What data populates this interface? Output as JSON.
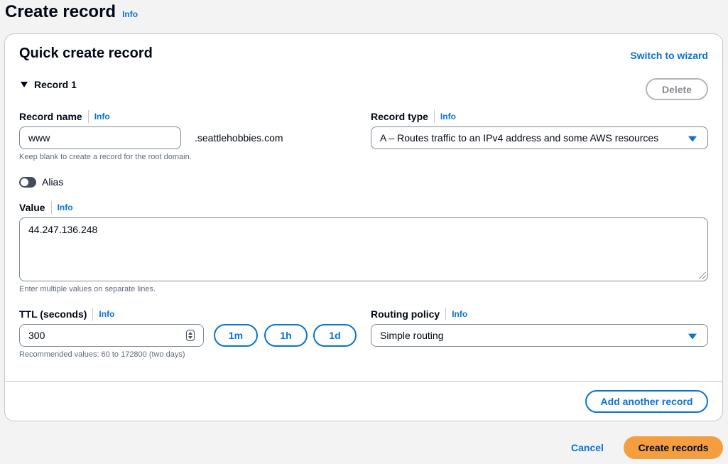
{
  "header": {
    "title": "Create record",
    "info": "Info"
  },
  "panel": {
    "title": "Quick create record",
    "switch_wizard": "Switch to wizard"
  },
  "record": {
    "toggle_label": "Record 1",
    "delete_label": "Delete",
    "record_name": {
      "label": "Record name",
      "info": "Info",
      "value": "www",
      "suffix": ".seattlehobbies.com",
      "hint": "Keep blank to create a record for the root domain."
    },
    "record_type": {
      "label": "Record type",
      "info": "Info",
      "value": "A – Routes traffic to an IPv4 address and some AWS resources"
    },
    "alias": {
      "label": "Alias",
      "enabled": false
    },
    "value_field": {
      "label": "Value",
      "info": "Info",
      "value": "44.247.136.248",
      "hint": "Enter multiple values on separate lines."
    },
    "ttl": {
      "label": "TTL (seconds)",
      "info": "Info",
      "value": "300",
      "hint": "Recommended values: 60 to 172800 (two days)",
      "presets": [
        "1m",
        "1h",
        "1d"
      ]
    },
    "routing_policy": {
      "label": "Routing policy",
      "info": "Info",
      "value": "Simple routing"
    }
  },
  "add_another": "Add another record",
  "footer": {
    "cancel": "Cancel",
    "create": "Create records"
  },
  "colors": {
    "link": "#0972d3",
    "primary_button": "#f49e3f",
    "text": "#000716",
    "border": "#7d8998"
  }
}
